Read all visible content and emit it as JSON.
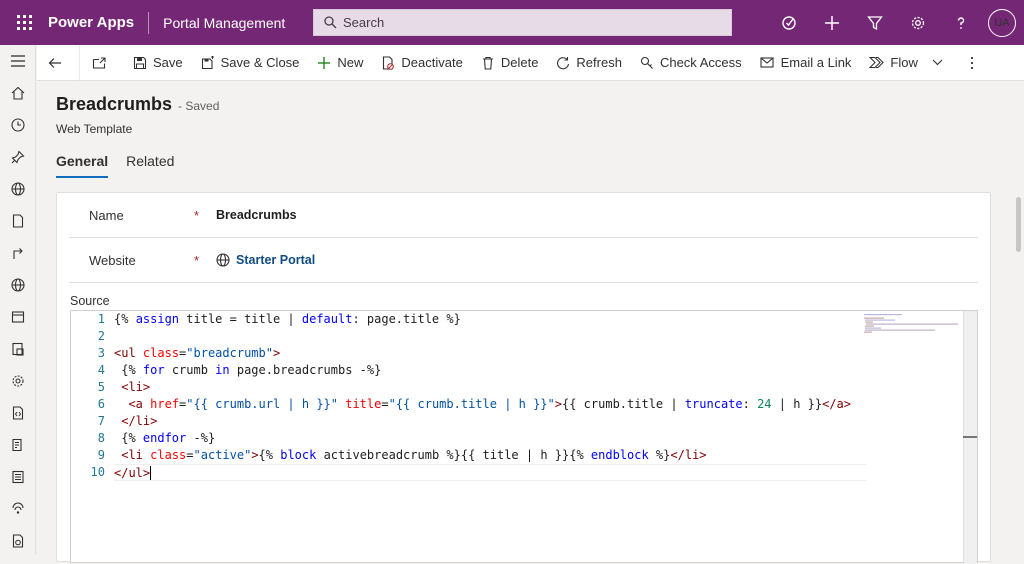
{
  "topbar": {
    "app_name": "Power Apps",
    "environment": "Portal Management",
    "search_placeholder": "Search",
    "avatar_initials": "UA",
    "icons": [
      "assistant-icon",
      "plus-icon",
      "filter-icon",
      "settings-icon",
      "help-icon"
    ],
    "bg_color": "#742774"
  },
  "commandbar": {
    "save": "Save",
    "save_close": "Save & Close",
    "new": "New",
    "deactivate": "Deactivate",
    "delete": "Delete",
    "refresh": "Refresh",
    "check_access": "Check Access",
    "email_link": "Email a Link",
    "flow": "Flow"
  },
  "record": {
    "title": "Breadcrumbs",
    "status": "- Saved",
    "entity_type": "Web Template"
  },
  "tabs": [
    "General",
    "Related"
  ],
  "form": {
    "name_label": "Name",
    "name_value": "Breadcrumbs",
    "website_label": "Website",
    "website_value": "Starter Portal",
    "required_marker": "*",
    "source_label": "Source"
  },
  "editor": {
    "line_numbers": [
      "1",
      "2",
      "3",
      "4",
      "5",
      "6",
      "7",
      "8",
      "9",
      "10"
    ]
  }
}
